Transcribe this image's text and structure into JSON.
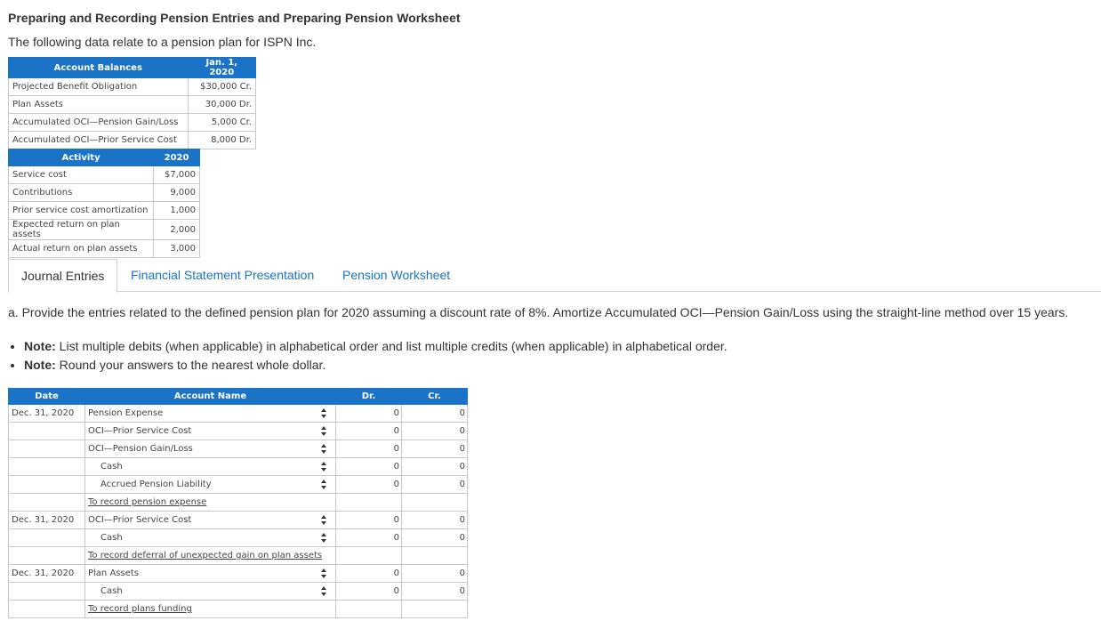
{
  "page": {
    "title": "Preparing and Recording Pension Entries and Preparing Pension Worksheet",
    "intro": "The following data relate to a pension plan for ISPN Inc."
  },
  "balances": {
    "header_left": "Account Balances",
    "header_right": "Jan. 1, 2020",
    "rows": [
      {
        "label": "Projected Benefit Obligation",
        "value": "$30,000 Cr."
      },
      {
        "label": "Plan Assets",
        "value": "30,000 Dr."
      },
      {
        "label": "Accumulated OCI—Pension Gain/Loss",
        "value": "5,000 Cr."
      },
      {
        "label": "Accumulated OCI—Prior Service Cost",
        "value": "8,000 Dr."
      }
    ]
  },
  "activity": {
    "header_left": "Activity",
    "header_right": "2020",
    "rows": [
      {
        "label": "Service cost",
        "value": "$7,000"
      },
      {
        "label": "Contributions",
        "value": "9,000"
      },
      {
        "label": "Prior service cost amortization",
        "value": "1,000"
      },
      {
        "label": "Expected return on plan assets",
        "value": "2,000"
      },
      {
        "label": "Actual return on plan assets",
        "value": "3,000"
      }
    ]
  },
  "tabs": [
    "Journal Entries",
    "Financial Statement Presentation",
    "Pension Worksheet"
  ],
  "question": "a. Provide the entries related to the defined pension plan for 2020 assuming a discount rate of 8%. Amortize Accumulated OCI—Pension Gain/Loss using the straight-line method over 15 years.",
  "notes": [
    {
      "label": "Note:",
      "text": " List multiple debits (when applicable) in alphabetical order and list multiple credits (when applicable) in alphabetical order."
    },
    {
      "label": "Note:",
      "text": " Round your answers to the nearest whole dollar."
    }
  ],
  "journal": {
    "headers": {
      "date": "Date",
      "account": "Account Name",
      "dr": "Dr.",
      "cr": "Cr."
    },
    "rows": [
      {
        "date": "Dec. 31, 2020",
        "account": "Pension Expense",
        "indent": false,
        "dr": "0",
        "cr": "0"
      },
      {
        "date": "",
        "account": "OCI—Prior Service Cost",
        "indent": false,
        "dr": "0",
        "cr": "0"
      },
      {
        "date": "",
        "account": "OCI—Pension Gain/Loss",
        "indent": false,
        "dr": "0",
        "cr": "0"
      },
      {
        "date": "",
        "account": "Cash",
        "indent": true,
        "dr": "0",
        "cr": "0"
      },
      {
        "date": "",
        "account": "Accrued Pension Liability",
        "indent": true,
        "dr": "0",
        "cr": "0"
      },
      {
        "desc": "To record pension expense"
      },
      {
        "date": "Dec. 31, 2020",
        "account": "OCI—Prior Service Cost",
        "indent": false,
        "dr": "0",
        "cr": "0"
      },
      {
        "date": "",
        "account": "Cash",
        "indent": true,
        "dr": "0",
        "cr": "0"
      },
      {
        "desc": "To record deferral of unexpected gain on plan assets"
      },
      {
        "date": "Dec. 31, 2020",
        "account": "Plan Assets",
        "indent": false,
        "dr": "0",
        "cr": "0"
      },
      {
        "date": "",
        "account": "Cash",
        "indent": true,
        "dr": "0",
        "cr": "0"
      },
      {
        "desc": "To record plans funding"
      }
    ]
  },
  "colors": {
    "accent": "#1a73c6",
    "border": "#c8c8c8"
  }
}
